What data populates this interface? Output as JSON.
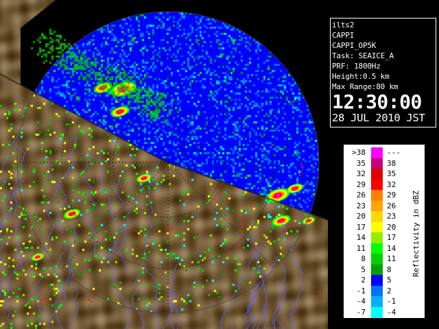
{
  "info": {
    "station": "ilts2",
    "product": "CAPPI",
    "product_id": "CAPPI_OP5K",
    "task": "Task: SEAICE_A",
    "prf": "PRF: 1800Hz",
    "height": "Height:0.5 km",
    "max_range": "Max Range:80 km",
    "time": "12:30:00",
    "date": "28 JUL 2010 JST"
  },
  "legend": {
    "unit": "Reflectivity in dBZ",
    "rows": [
      {
        "lo": ">38",
        "hi": "---",
        "color": "#ff00ff"
      },
      {
        "lo": "35",
        "hi": "38",
        "color": "#c8007a"
      },
      {
        "lo": "32",
        "hi": "35",
        "color": "#e00000"
      },
      {
        "lo": "29",
        "hi": "32",
        "color": "#ff0000"
      },
      {
        "lo": "26",
        "hi": "29",
        "color": "#ff7f00"
      },
      {
        "lo": "23",
        "hi": "26",
        "color": "#ffa500"
      },
      {
        "lo": "20",
        "hi": "23",
        "color": "#ffd700"
      },
      {
        "lo": "17",
        "hi": "20",
        "color": "#ffff00"
      },
      {
        "lo": "14",
        "hi": "17",
        "color": "#90ee00"
      },
      {
        "lo": "11",
        "hi": "14",
        "color": "#00ff00"
      },
      {
        "lo": "8",
        "hi": "11",
        "color": "#00d000"
      },
      {
        "lo": "5",
        "hi": "8",
        "color": "#00a000"
      },
      {
        "lo": "2",
        "hi": "5",
        "color": "#0000ff"
      },
      {
        "lo": "-1",
        "hi": "2",
        "color": "#0070ff"
      },
      {
        "lo": "-4",
        "hi": "-1",
        "color": "#00b0ff"
      },
      {
        "lo": "-7",
        "hi": "-4",
        "color": "#00ffff"
      }
    ]
  },
  "colors": {
    "sea": "#0000ff",
    "land": "#7a5a3a",
    "background": "#000000",
    "coastline": "#ffffff",
    "rivers": "#6060ff"
  },
  "icons": {
    "radar_image": "radar-reflectivity-map"
  }
}
